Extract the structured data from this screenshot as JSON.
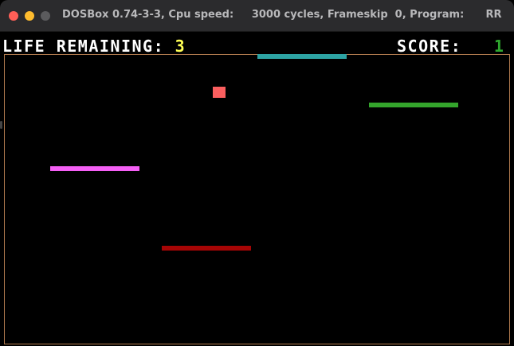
{
  "window": {
    "title": "DOSBox 0.74-3-3, Cpu speed:     3000 cycles, Frameskip  0, Program:      RR",
    "buttons": {
      "close": "close-button",
      "minimize": "minimize-button",
      "maximize": "maximize-button"
    },
    "colors": {
      "close": "#fe5f57",
      "minimize": "#febc2e",
      "maximize": "#5b5b5d",
      "titlebar": "#2b2b2d"
    }
  },
  "hud": {
    "life_label": "LIFE REMAINING:",
    "life_value": "3",
    "score_label": "SCORE:",
    "score_value": "1"
  },
  "game": {
    "paddles": [
      {
        "name": "paddle-teal",
        "color": "#2da3a3"
      },
      {
        "name": "paddle-green",
        "color": "#34a52c"
      },
      {
        "name": "paddle-magenta",
        "color": "#f45ff4"
      },
      {
        "name": "paddle-red",
        "color": "#a60505"
      }
    ],
    "ball": {
      "color": "#fb5f5f"
    },
    "border_color": "#b07a4e"
  }
}
